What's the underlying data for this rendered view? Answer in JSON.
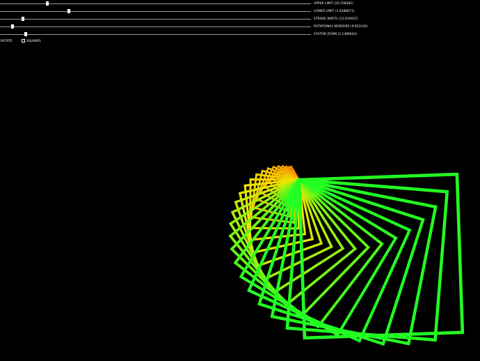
{
  "sliders": [
    {
      "label": "UPPER LIMIT (20.258583)",
      "fraction": 0.15
    },
    {
      "label": "LOWER LIMIT (3.6286871)",
      "fraction": 0.22
    },
    {
      "label": "STROKE WIDTH (12.910937)",
      "fraction": 0.07
    },
    {
      "label": "ROTATIONAL MODIFIER (9.953126)",
      "fraction": 0.035
    },
    {
      "label": "SYSTEM ZOOM (2.1380624)",
      "fraction": 0.08
    }
  ],
  "toggles": {
    "rotate_label": "ROTATE",
    "squares_label": "SQUARES",
    "squares_checked": false
  },
  "colors": {
    "background": "#000000",
    "inner": "#ff8a00",
    "mid": "#f2e600",
    "outer": "#22ff22"
  },
  "art": {
    "square_count": 24
  }
}
